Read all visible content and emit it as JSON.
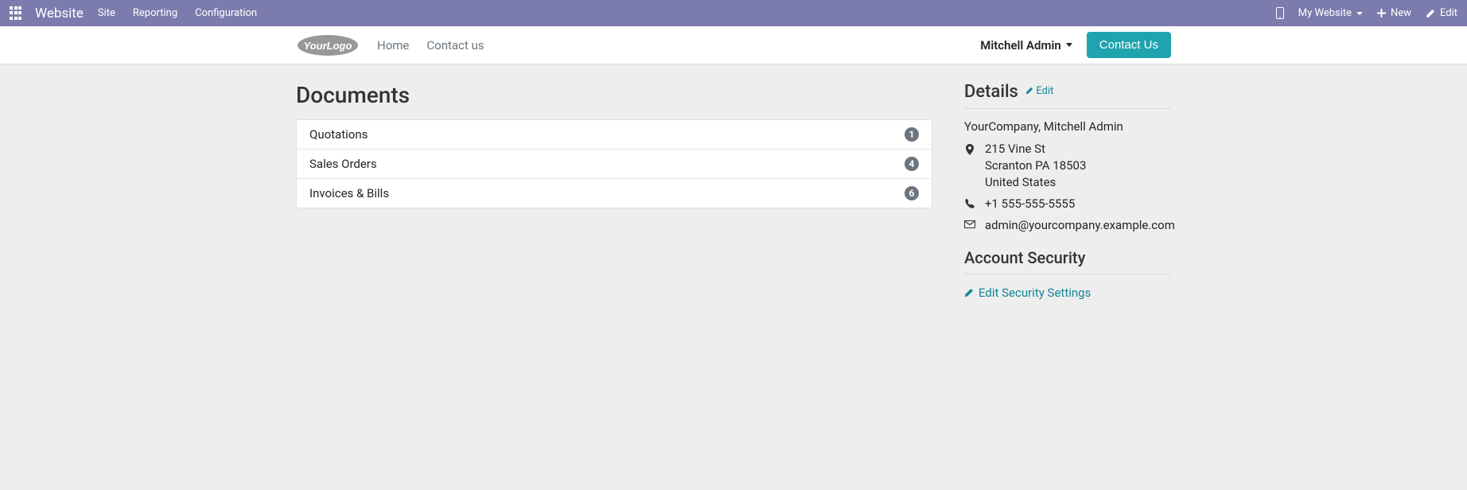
{
  "topbar": {
    "brand": "Website",
    "menu": [
      "Site",
      "Reporting",
      "Configuration"
    ],
    "mobile_icon": "mobile",
    "site_switcher": "My Website",
    "new_label": "New",
    "edit_label": "Edit"
  },
  "nav": {
    "logo_text": "YourLogo",
    "links": [
      "Home",
      "Contact us"
    ],
    "user": "Mitchell Admin",
    "cta": "Contact Us"
  },
  "documents": {
    "title": "Documents",
    "rows": [
      {
        "label": "Quotations",
        "count": "1"
      },
      {
        "label": "Sales Orders",
        "count": "4"
      },
      {
        "label": "Invoices & Bills",
        "count": "6"
      }
    ]
  },
  "details": {
    "heading": "Details",
    "edit": "Edit",
    "company_line": "YourCompany, Mitchell Admin",
    "address_line1": "215 Vine St",
    "address_line2": "Scranton PA 18503",
    "address_line3": "United States",
    "phone": "+1 555-555-5555",
    "email": "admin@yourcompany.example.com"
  },
  "security": {
    "heading": "Account Security",
    "link": "Edit Security Settings"
  }
}
